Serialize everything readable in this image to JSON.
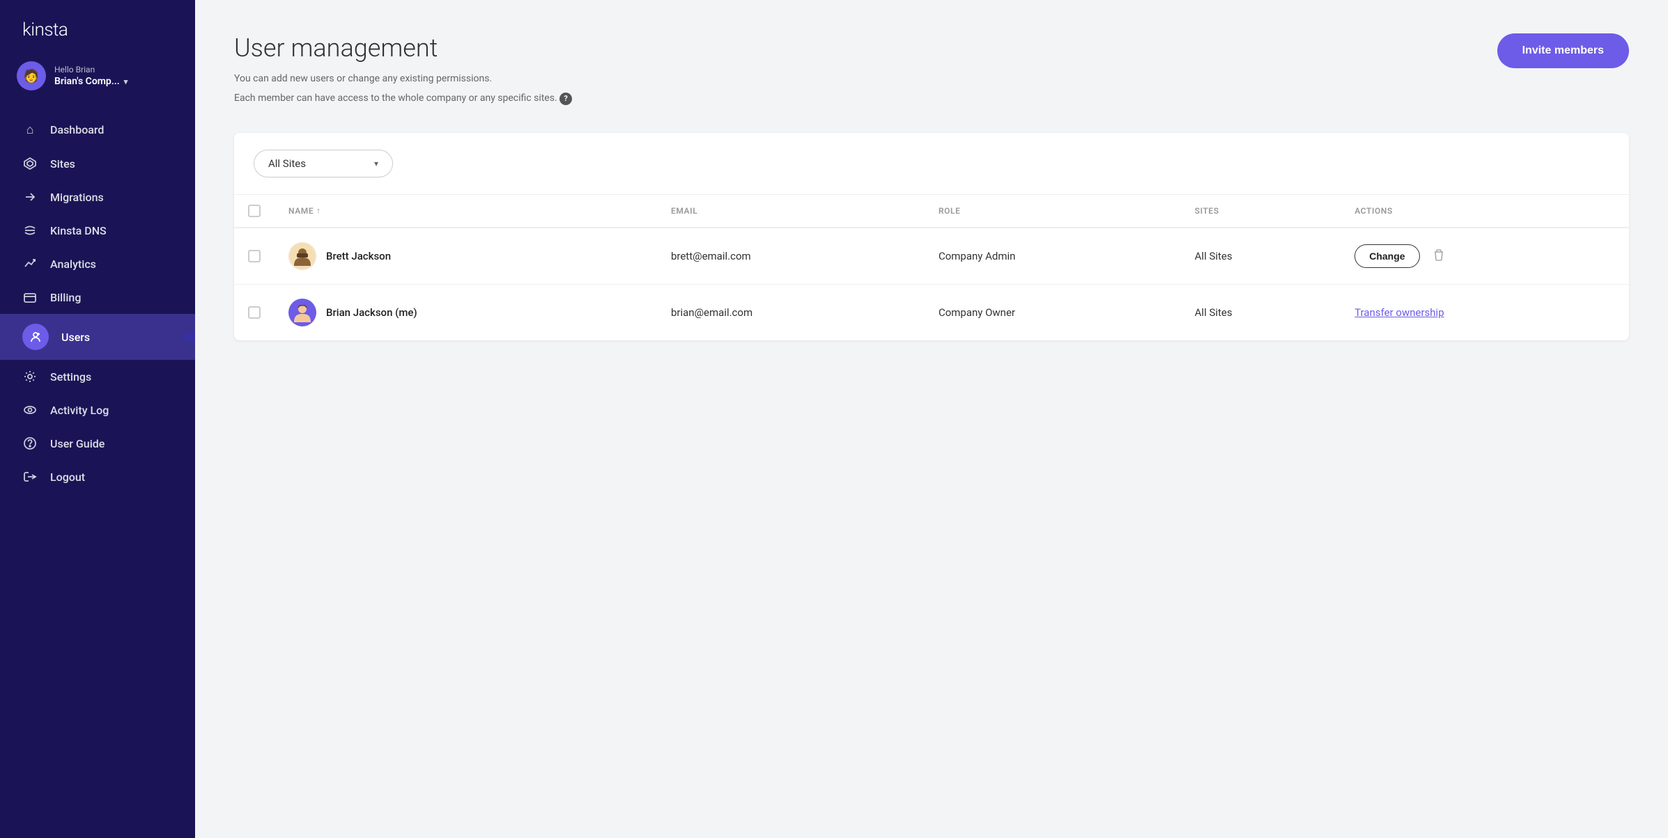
{
  "sidebar": {
    "logo": "kinsta",
    "user": {
      "greeting": "Hello Brian",
      "company": "Brian's Comp...",
      "avatar_emoji": "👤"
    },
    "items": [
      {
        "id": "dashboard",
        "label": "Dashboard",
        "icon": "🏠",
        "active": false
      },
      {
        "id": "sites",
        "label": "Sites",
        "icon": "◈",
        "active": false
      },
      {
        "id": "migrations",
        "label": "Migrations",
        "icon": "➤",
        "active": false
      },
      {
        "id": "kinsta-dns",
        "label": "Kinsta DNS",
        "icon": "⇄",
        "active": false
      },
      {
        "id": "analytics",
        "label": "Analytics",
        "icon": "↗",
        "active": false
      },
      {
        "id": "billing",
        "label": "Billing",
        "icon": "⊟",
        "active": false
      },
      {
        "id": "users",
        "label": "Users",
        "icon": "👤+",
        "active": true
      },
      {
        "id": "settings",
        "label": "Settings",
        "icon": "⚙",
        "active": false
      },
      {
        "id": "activity-log",
        "label": "Activity Log",
        "icon": "👁",
        "active": false
      },
      {
        "id": "user-guide",
        "label": "User Guide",
        "icon": "❓",
        "active": false
      },
      {
        "id": "logout",
        "label": "Logout",
        "icon": "⏻",
        "active": false
      }
    ]
  },
  "main": {
    "title": "User management",
    "subtitle_line1": "You can add new users or change any existing permissions.",
    "subtitle_line2": "Each member can have access to the whole company or any specific sites.",
    "invite_btn": "Invite members",
    "filter": {
      "label": "All Sites"
    },
    "table": {
      "columns": [
        {
          "id": "checkbox",
          "label": ""
        },
        {
          "id": "name",
          "label": "NAME"
        },
        {
          "id": "email",
          "label": "EMAIL"
        },
        {
          "id": "role",
          "label": "ROLE"
        },
        {
          "id": "sites",
          "label": "SITES"
        },
        {
          "id": "actions",
          "label": "ACTIONS"
        }
      ],
      "rows": [
        {
          "id": "brett",
          "name": "Brett Jackson",
          "email": "brett@email.com",
          "role": "Company Admin",
          "sites": "All Sites",
          "action_type": "change",
          "action_label": "Change",
          "avatar_emoji": "🧔"
        },
        {
          "id": "brian",
          "name": "Brian Jackson (me)",
          "email": "brian@email.com",
          "role": "Company Owner",
          "sites": "All Sites",
          "action_type": "transfer",
          "action_label": "Transfer ownership",
          "avatar_emoji": "👦"
        }
      ]
    }
  }
}
